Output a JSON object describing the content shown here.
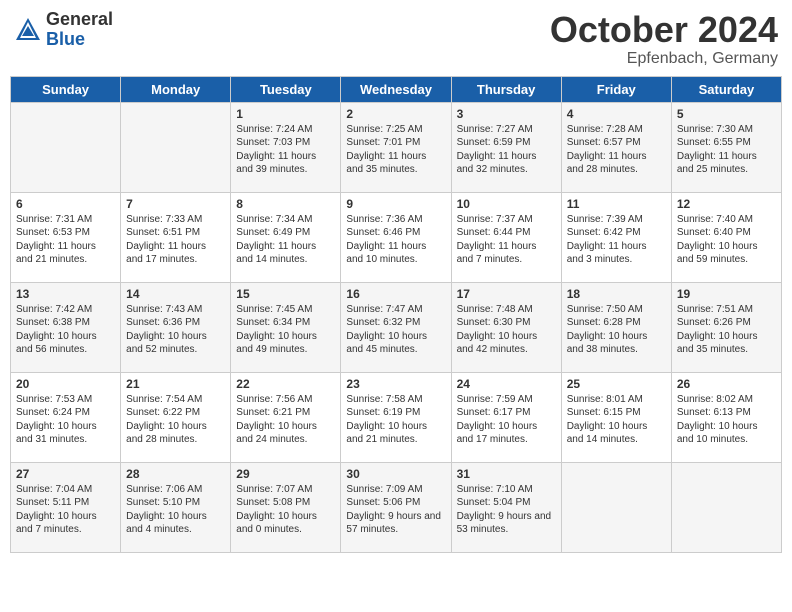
{
  "header": {
    "logo_general": "General",
    "logo_blue": "Blue",
    "month_title": "October 2024",
    "location": "Epfenbach, Germany"
  },
  "days_of_week": [
    "Sunday",
    "Monday",
    "Tuesday",
    "Wednesday",
    "Thursday",
    "Friday",
    "Saturday"
  ],
  "weeks": [
    [
      {
        "day": "",
        "info": ""
      },
      {
        "day": "",
        "info": ""
      },
      {
        "day": "1",
        "info": "Sunrise: 7:24 AM\nSunset: 7:03 PM\nDaylight: 11 hours and 39 minutes."
      },
      {
        "day": "2",
        "info": "Sunrise: 7:25 AM\nSunset: 7:01 PM\nDaylight: 11 hours and 35 minutes."
      },
      {
        "day": "3",
        "info": "Sunrise: 7:27 AM\nSunset: 6:59 PM\nDaylight: 11 hours and 32 minutes."
      },
      {
        "day": "4",
        "info": "Sunrise: 7:28 AM\nSunset: 6:57 PM\nDaylight: 11 hours and 28 minutes."
      },
      {
        "day": "5",
        "info": "Sunrise: 7:30 AM\nSunset: 6:55 PM\nDaylight: 11 hours and 25 minutes."
      }
    ],
    [
      {
        "day": "6",
        "info": "Sunrise: 7:31 AM\nSunset: 6:53 PM\nDaylight: 11 hours and 21 minutes."
      },
      {
        "day": "7",
        "info": "Sunrise: 7:33 AM\nSunset: 6:51 PM\nDaylight: 11 hours and 17 minutes."
      },
      {
        "day": "8",
        "info": "Sunrise: 7:34 AM\nSunset: 6:49 PM\nDaylight: 11 hours and 14 minutes."
      },
      {
        "day": "9",
        "info": "Sunrise: 7:36 AM\nSunset: 6:46 PM\nDaylight: 11 hours and 10 minutes."
      },
      {
        "day": "10",
        "info": "Sunrise: 7:37 AM\nSunset: 6:44 PM\nDaylight: 11 hours and 7 minutes."
      },
      {
        "day": "11",
        "info": "Sunrise: 7:39 AM\nSunset: 6:42 PM\nDaylight: 11 hours and 3 minutes."
      },
      {
        "day": "12",
        "info": "Sunrise: 7:40 AM\nSunset: 6:40 PM\nDaylight: 10 hours and 59 minutes."
      }
    ],
    [
      {
        "day": "13",
        "info": "Sunrise: 7:42 AM\nSunset: 6:38 PM\nDaylight: 10 hours and 56 minutes."
      },
      {
        "day": "14",
        "info": "Sunrise: 7:43 AM\nSunset: 6:36 PM\nDaylight: 10 hours and 52 minutes."
      },
      {
        "day": "15",
        "info": "Sunrise: 7:45 AM\nSunset: 6:34 PM\nDaylight: 10 hours and 49 minutes."
      },
      {
        "day": "16",
        "info": "Sunrise: 7:47 AM\nSunset: 6:32 PM\nDaylight: 10 hours and 45 minutes."
      },
      {
        "day": "17",
        "info": "Sunrise: 7:48 AM\nSunset: 6:30 PM\nDaylight: 10 hours and 42 minutes."
      },
      {
        "day": "18",
        "info": "Sunrise: 7:50 AM\nSunset: 6:28 PM\nDaylight: 10 hours and 38 minutes."
      },
      {
        "day": "19",
        "info": "Sunrise: 7:51 AM\nSunset: 6:26 PM\nDaylight: 10 hours and 35 minutes."
      }
    ],
    [
      {
        "day": "20",
        "info": "Sunrise: 7:53 AM\nSunset: 6:24 PM\nDaylight: 10 hours and 31 minutes."
      },
      {
        "day": "21",
        "info": "Sunrise: 7:54 AM\nSunset: 6:22 PM\nDaylight: 10 hours and 28 minutes."
      },
      {
        "day": "22",
        "info": "Sunrise: 7:56 AM\nSunset: 6:21 PM\nDaylight: 10 hours and 24 minutes."
      },
      {
        "day": "23",
        "info": "Sunrise: 7:58 AM\nSunset: 6:19 PM\nDaylight: 10 hours and 21 minutes."
      },
      {
        "day": "24",
        "info": "Sunrise: 7:59 AM\nSunset: 6:17 PM\nDaylight: 10 hours and 17 minutes."
      },
      {
        "day": "25",
        "info": "Sunrise: 8:01 AM\nSunset: 6:15 PM\nDaylight: 10 hours and 14 minutes."
      },
      {
        "day": "26",
        "info": "Sunrise: 8:02 AM\nSunset: 6:13 PM\nDaylight: 10 hours and 10 minutes."
      }
    ],
    [
      {
        "day": "27",
        "info": "Sunrise: 7:04 AM\nSunset: 5:11 PM\nDaylight: 10 hours and 7 minutes."
      },
      {
        "day": "28",
        "info": "Sunrise: 7:06 AM\nSunset: 5:10 PM\nDaylight: 10 hours and 4 minutes."
      },
      {
        "day": "29",
        "info": "Sunrise: 7:07 AM\nSunset: 5:08 PM\nDaylight: 10 hours and 0 minutes."
      },
      {
        "day": "30",
        "info": "Sunrise: 7:09 AM\nSunset: 5:06 PM\nDaylight: 9 hours and 57 minutes."
      },
      {
        "day": "31",
        "info": "Sunrise: 7:10 AM\nSunset: 5:04 PM\nDaylight: 9 hours and 53 minutes."
      },
      {
        "day": "",
        "info": ""
      },
      {
        "day": "",
        "info": ""
      }
    ]
  ]
}
